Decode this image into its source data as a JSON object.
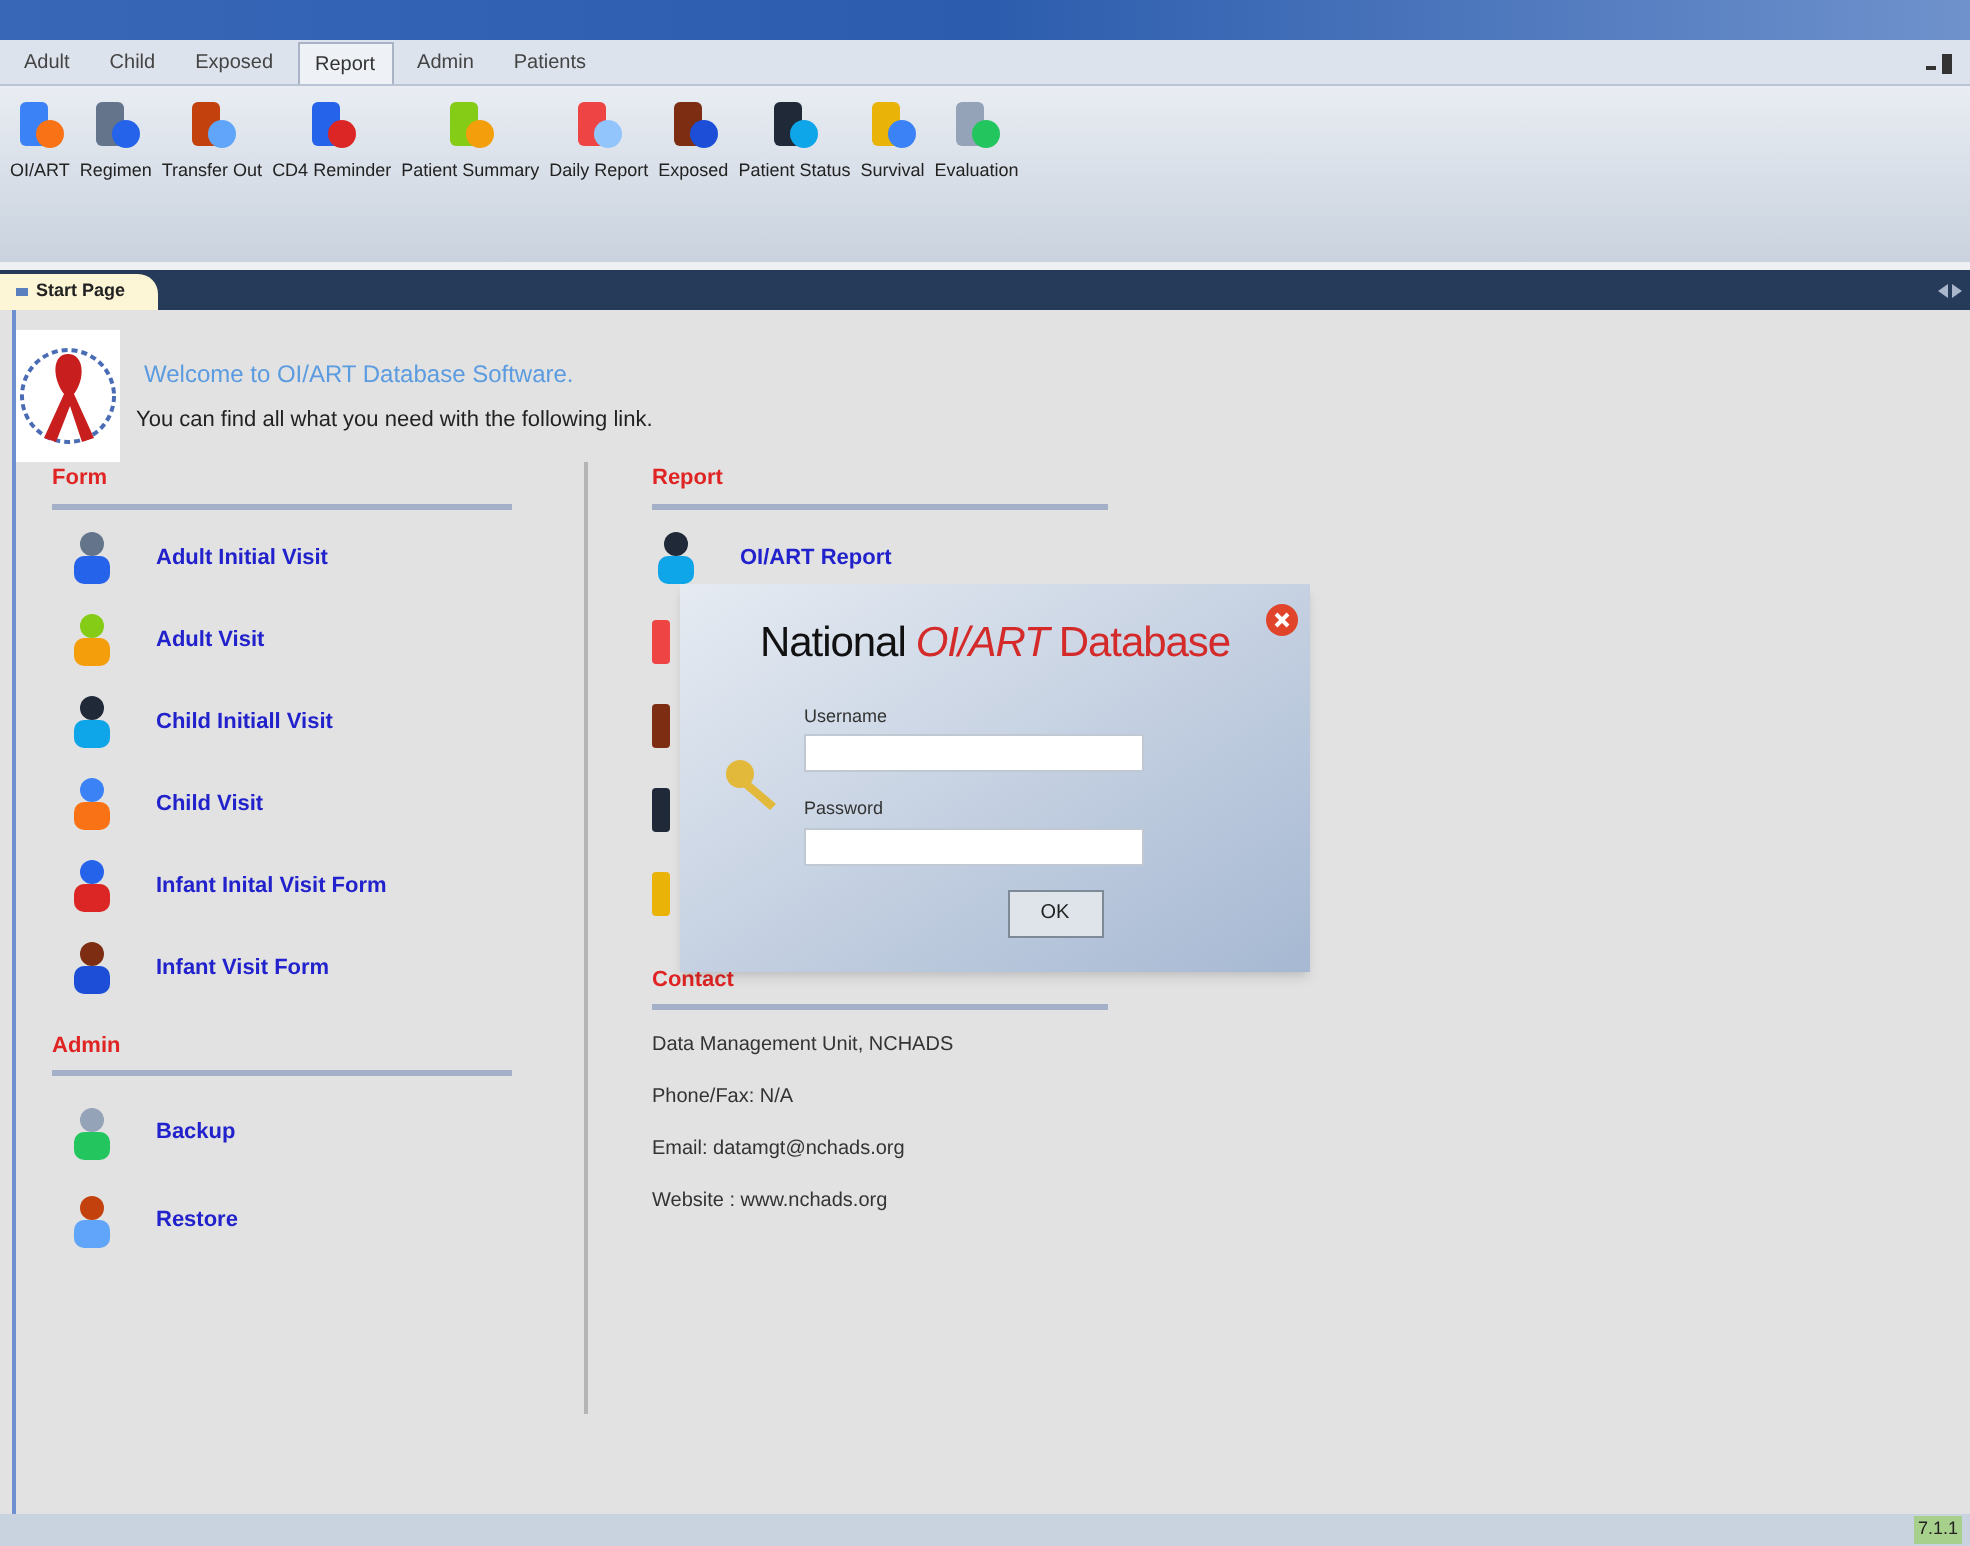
{
  "menu_tabs": [
    {
      "label": "Adult",
      "selected": false
    },
    {
      "label": "Child",
      "selected": false
    },
    {
      "label": "Exposed",
      "selected": false
    },
    {
      "label": "Report",
      "selected": true
    },
    {
      "label": "Admin",
      "selected": false
    },
    {
      "label": "Patients",
      "selected": false
    }
  ],
  "toolbar": [
    {
      "label": "OI/ART"
    },
    {
      "label": "Regimen"
    },
    {
      "label": "Transfer Out"
    },
    {
      "label": "CD4 Reminder"
    },
    {
      "label": "Patient Summary"
    },
    {
      "label": "Daily Report"
    },
    {
      "label": "Exposed"
    },
    {
      "label": "Patient Status"
    },
    {
      "label": "Survival"
    },
    {
      "label": "Evaluation"
    }
  ],
  "document_tab": {
    "label": "Start Page"
  },
  "welcome": {
    "title": "Welcome to OI/ART Database Software.",
    "subtitle": "You can find all what you need with the following link."
  },
  "form_section": {
    "heading": "Form",
    "items": [
      {
        "label": "Adult Initial Visit"
      },
      {
        "label": "Adult Visit"
      },
      {
        "label": "Child Initiall Visit"
      },
      {
        "label": "Child Visit"
      },
      {
        "label": "Infant Inital Visit Form"
      },
      {
        "label": "Infant Visit Form"
      }
    ]
  },
  "admin_section": {
    "heading": "Admin",
    "items": [
      {
        "label": "Backup"
      },
      {
        "label": "Restore"
      }
    ]
  },
  "report_section": {
    "heading": "Report",
    "items": [
      {
        "label": "OI/ART Report"
      }
    ]
  },
  "contact_section": {
    "heading": "Contact",
    "lines": [
      "Data Management Unit, NCHADS",
      "Phone/Fax: N/A",
      "Email: datamgt@nchads.org",
      "Website : www.nchads.org"
    ]
  },
  "login_dialog": {
    "title_start": "National",
    "title_middle": "OI/ART",
    "title_end": "Database",
    "username_label": "Username",
    "password_label": "Password",
    "ok_button": "OK"
  },
  "status_bar": {
    "version": "7.1.1"
  }
}
